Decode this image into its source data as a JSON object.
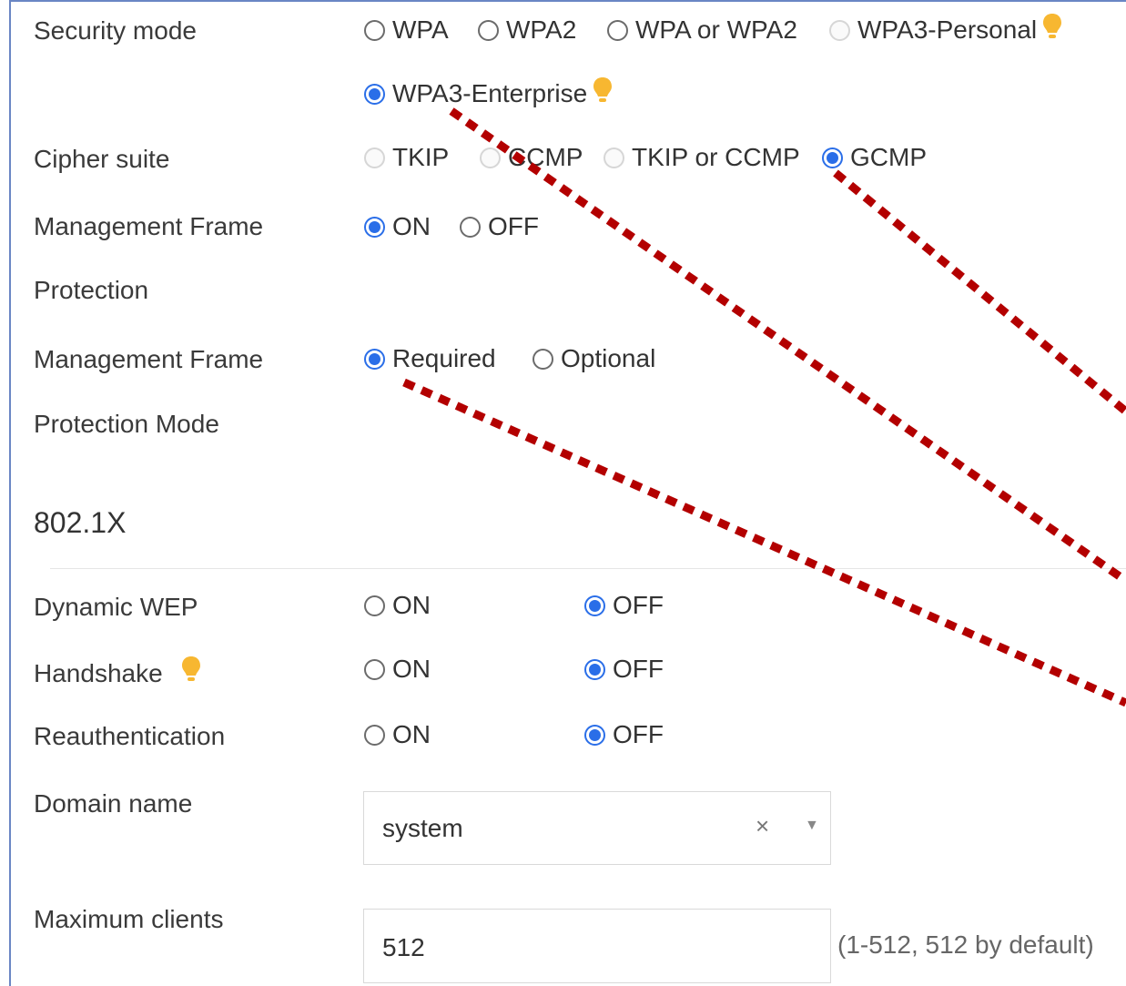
{
  "security_mode": {
    "label": "Security mode",
    "options": [
      "WPA",
      "WPA2",
      "WPA or WPA2",
      "WPA3-Personal",
      "WPA3-Enterprise"
    ],
    "selected": "WPA3-Enterprise"
  },
  "cipher_suite": {
    "label": "Cipher suite",
    "options": [
      "TKIP",
      "CCMP",
      "TKIP or CCMP",
      "GCMP"
    ],
    "selected": "GCMP"
  },
  "mfp": {
    "label_line1": "Management Frame",
    "label_line2": "Protection",
    "on": "ON",
    "off": "OFF",
    "selected": "ON"
  },
  "mfp_mode": {
    "label_line1": "Management Frame",
    "label_line2": "Protection Mode",
    "required": "Required",
    "optional": "Optional",
    "selected": "Required"
  },
  "section_8021x": {
    "title": "802.1X"
  },
  "dynamic_wep": {
    "label": "Dynamic WEP",
    "on": "ON",
    "off": "OFF",
    "selected": "OFF"
  },
  "handshake": {
    "label": "Handshake",
    "on": "ON",
    "off": "OFF",
    "selected": "OFF"
  },
  "reauthentication": {
    "label": "Reauthentication",
    "on": "ON",
    "off": "OFF",
    "selected": "OFF"
  },
  "domain_name": {
    "label": "Domain name",
    "value": "system",
    "clear_glyph": "×",
    "caret_glyph": "▼"
  },
  "max_clients": {
    "label": "Maximum clients",
    "value": "512",
    "hint": "(1-512, 512 by default)"
  },
  "colors": {
    "accent_blue": "#2a6ee8",
    "hint_bulb": "#f7b731",
    "annotation_red": "#b30000",
    "frame_border": "#6a86c4"
  }
}
